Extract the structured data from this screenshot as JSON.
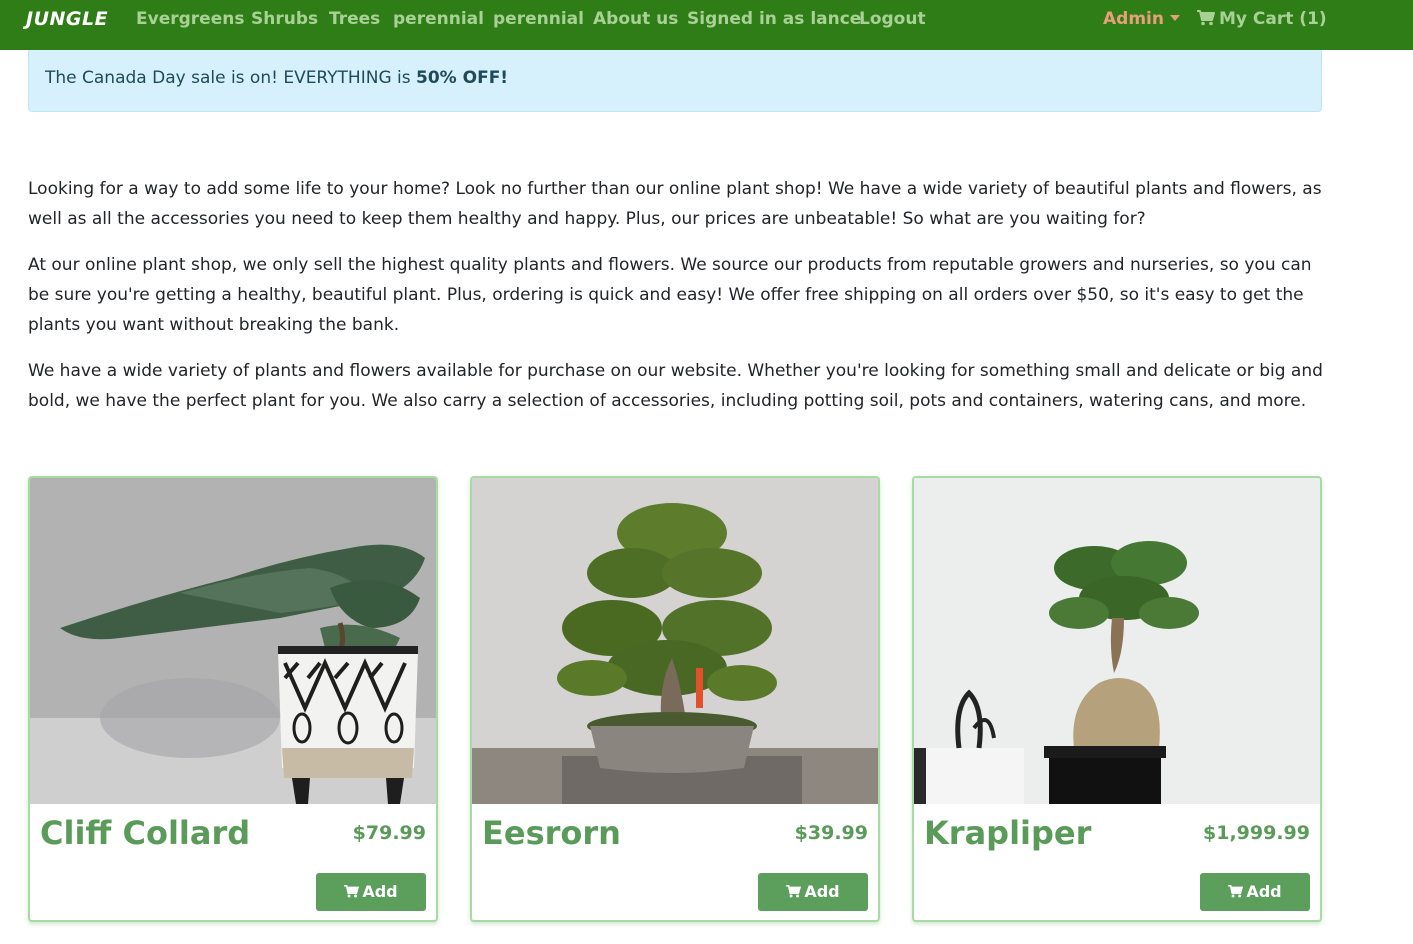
{
  "navbar": {
    "brand": "JUNGLE",
    "links": [
      "Evergreens",
      "Shrubs",
      "Trees",
      "perennial",
      "perennial",
      "About us",
      "Signed in as lance",
      "Logout"
    ],
    "admin": "Admin",
    "cart": "My Cart (1)"
  },
  "alert": {
    "text": "The Canada Day sale is on! EVERYTHING is ",
    "bold": "50% OFF!"
  },
  "intro": {
    "paragraphs": [
      "Looking for a way to add some life to your home? Look no further than our online plant shop! We have a wide variety of beautiful plants and flowers, as well as all the accessories you need to keep them healthy and happy. Plus, our prices are unbeatable! So what are you waiting for?",
      "At our online plant shop, we only sell the highest quality plants and flowers. We source our products from reputable growers and nurseries, so you can be sure you're getting a healthy, beautiful plant. Plus, ordering is quick and easy! We offer free shipping on all orders over $50, so it's easy to get the plants you want without breaking the bank.",
      "We have a wide variety of plants and flowers available for purchase on our website. Whether you're looking for something small and delicate or big and bold, we have the perfect plant for you. We also carry a selection of accessories, including potting soil, pots and containers, watering cans, and more."
    ]
  },
  "products": [
    {
      "name": "Cliff Collard",
      "price": "$79.99",
      "add_label": "Add"
    },
    {
      "name": "Eesrorn",
      "price": "$39.99",
      "add_label": "Add"
    },
    {
      "name": "Krapliper",
      "price": "$1,999.99",
      "add_label": "Add"
    }
  ],
  "colors": {
    "navbar": "#2e7d17",
    "nav_link": "#a9d196",
    "admin": "#e8a07a",
    "alert_bg": "#d6f1fb",
    "product_text": "#5a9b5a",
    "button": "#5c9e5c",
    "card_border": "#a8dba4"
  },
  "icons": {
    "cart": "shopping-cart-icon",
    "admin_dropdown": "caret-down-icon"
  }
}
